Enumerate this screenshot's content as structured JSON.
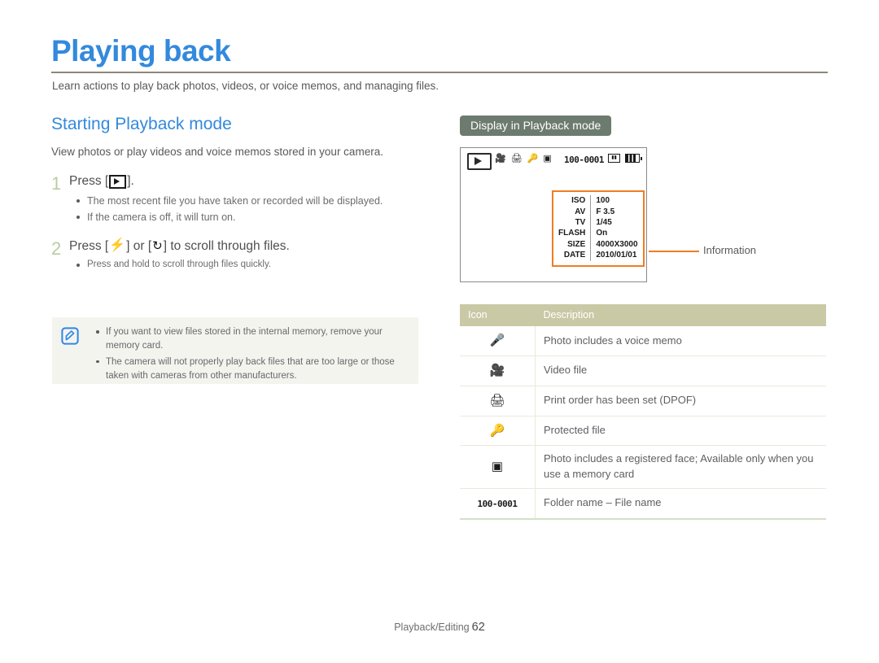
{
  "document": {
    "title": "Playing back",
    "intro": "Learn actions to play back photos, videos, or voice memos, and managing files."
  },
  "left": {
    "section_title": "Starting Playback mode",
    "lead": "View photos or play videos and voice memos stored in your camera.",
    "steps": [
      {
        "number": "1",
        "text_before": "Press [",
        "icon": "play-button-icon",
        "text_after": "].",
        "bullets": [
          "The most recent file you have taken or recorded will be displayed.",
          "If the camera is off, it will turn on."
        ]
      },
      {
        "number": "2",
        "text_before": "Press [",
        "icon_1": "flash-icon",
        "text_middle": "] or [",
        "icon_2": "self-timer-icon",
        "text_after": "] to scroll through files.",
        "bullets": [
          "Press and hold to scroll through files quickly."
        ]
      }
    ],
    "note": {
      "icon": "note-pen-icon",
      "bullets": [
        "If you want to view files stored in the internal memory, remove your memory card.",
        "The camera will not properly play back files that are too large or those taken with cameras from other manufacturers."
      ]
    }
  },
  "right": {
    "tag_label": "Display in Playback mode",
    "lcd": {
      "mode_icon": "playback-mode-icon",
      "status_icons": [
        "video-camera-icon",
        "printer-icon",
        "key-lock-icon",
        "face-recognition-icon"
      ],
      "file_label": "100-0001",
      "card_icon": "memory-card-icon",
      "battery_icon": "battery-full-icon",
      "info_rows": [
        {
          "key": "ISO",
          "value": "100"
        },
        {
          "key": "AV",
          "value": "F 3.5"
        },
        {
          "key": "TV",
          "value": "1/45"
        },
        {
          "key": "FLASH",
          "value": "On"
        },
        {
          "key": "SIZE",
          "value": "4000X3000"
        },
        {
          "key": "DATE",
          "value": "2010/01/01"
        }
      ]
    },
    "callout_label": "Information",
    "table": {
      "headers": {
        "icon": "Icon",
        "description": "Description"
      },
      "rows": [
        {
          "icon": "microphone-icon",
          "description": "Photo includes a voice memo"
        },
        {
          "icon": "video-camera-icon",
          "description": "Video file"
        },
        {
          "icon": "printer-icon",
          "description": "Print order has been set (DPOF)"
        },
        {
          "icon": "key-lock-icon",
          "description": "Protected file"
        },
        {
          "icon": "face-recognition-icon",
          "description": "Photo includes a registered face; Available only when you use a memory card"
        },
        {
          "icon": "file-number-text",
          "icon_text": "100-0001",
          "description": "Folder name – File name"
        }
      ]
    }
  },
  "footer": {
    "section": "Playback/Editing",
    "page": "62"
  },
  "colors": {
    "title_blue": "#3389dd",
    "rule_gray": "#8c8778",
    "step_number_green": "#b9cda1",
    "tag_green": "#6d7b6f",
    "table_header": "#c9c9a6",
    "callout_orange": "#f07d23",
    "note_bg": "#f4f4ef",
    "note_icon_blue": "#2f87e8"
  }
}
